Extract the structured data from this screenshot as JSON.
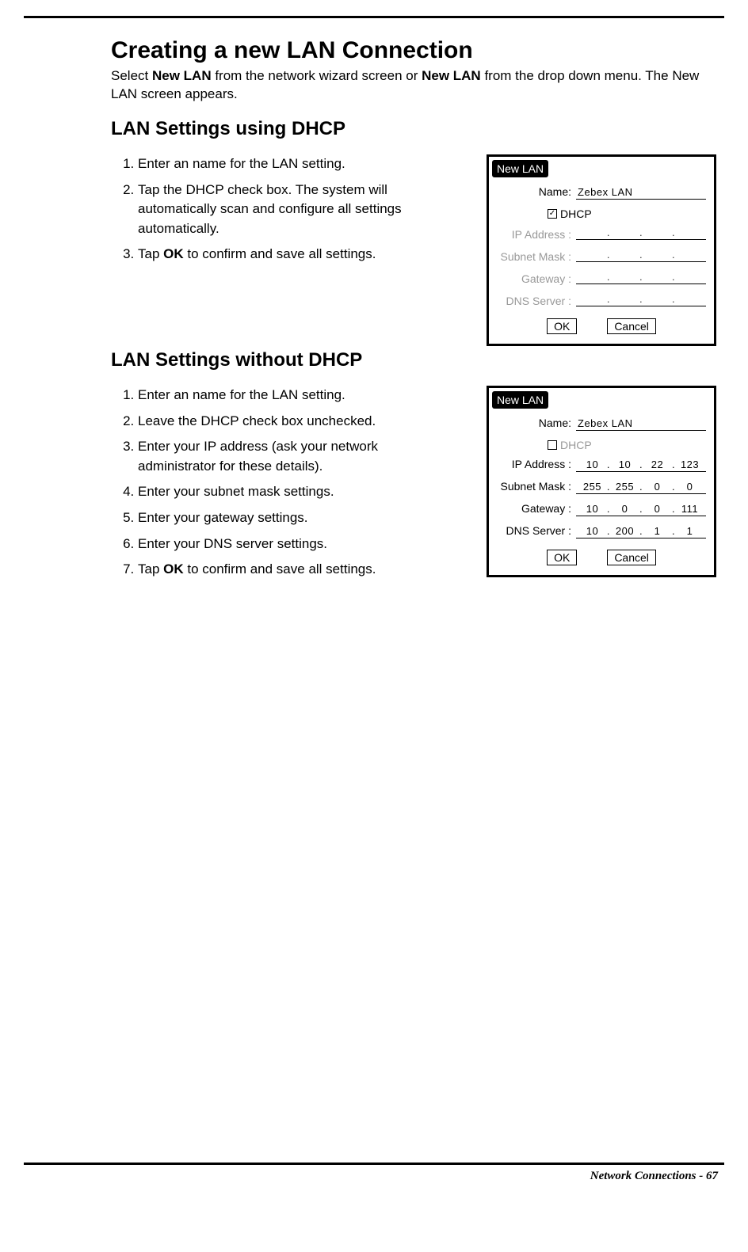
{
  "page": {
    "heading": "Creating a new LAN Connection",
    "intro_parts": [
      "Select ",
      "New LAN",
      " from the network wizard screen or ",
      "New LAN",
      " from the drop down menu. The New LAN screen appears."
    ],
    "footer": "Network Connections - 67"
  },
  "section_dhcp": {
    "heading": "LAN Settings using DHCP",
    "steps": [
      "Enter an name for the LAN setting.",
      "Tap the DHCP check box. The system will automatically scan and configure all settings automatically.",
      [
        "Tap ",
        "OK",
        " to confirm and save all settings."
      ]
    ],
    "dialog": {
      "title": "New LAN",
      "name_label": "Name:",
      "name_value": "Zebex LAN",
      "dhcp_label": "DHCP",
      "dhcp_checked": true,
      "fields": {
        "ip": {
          "label": "IP Address :",
          "octets": [
            "",
            "",
            "",
            ""
          ]
        },
        "mask": {
          "label": "Subnet Mask :",
          "octets": [
            "",
            "",
            "",
            ""
          ]
        },
        "gateway": {
          "label": "Gateway :",
          "octets": [
            "",
            "",
            "",
            ""
          ]
        },
        "dns": {
          "label": "DNS Server :",
          "octets": [
            "",
            "",
            "",
            ""
          ]
        }
      },
      "ok": "OK",
      "cancel": "Cancel"
    }
  },
  "section_nodhcp": {
    "heading": "LAN Settings without DHCP",
    "steps": [
      "Enter an name for the LAN setting.",
      "Leave the DHCP check box unchecked.",
      "Enter your IP address (ask your network administrator for these details).",
      "Enter your subnet mask settings.",
      "Enter your gateway settings.",
      "Enter your DNS server settings.",
      [
        "Tap ",
        "OK",
        " to confirm and save all settings."
      ]
    ],
    "dialog": {
      "title": "New LAN",
      "name_label": "Name:",
      "name_value": "Zebex LAN",
      "dhcp_label": "DHCP",
      "dhcp_checked": false,
      "fields": {
        "ip": {
          "label": "IP Address :",
          "octets": [
            "10",
            "10",
            "22",
            "123"
          ]
        },
        "mask": {
          "label": "Subnet Mask :",
          "octets": [
            "255",
            "255",
            "0",
            "0"
          ]
        },
        "gateway": {
          "label": "Gateway :",
          "octets": [
            "10",
            "0",
            "0",
            "111"
          ]
        },
        "dns": {
          "label": "DNS Server :",
          "octets": [
            "10",
            "200",
            "1",
            "1"
          ]
        }
      },
      "ok": "OK",
      "cancel": "Cancel"
    }
  }
}
